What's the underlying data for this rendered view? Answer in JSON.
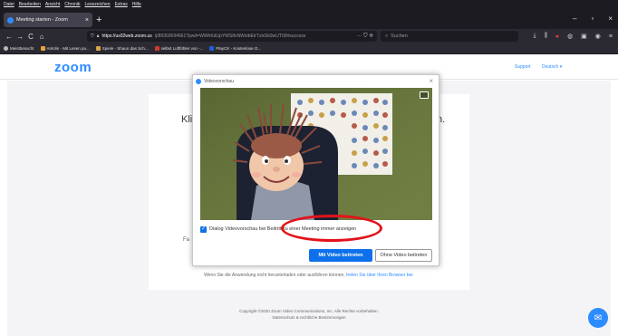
{
  "menubar": [
    "Datei",
    "Bearbeiten",
    "Ansicht",
    "Chronik",
    "Lesezeichen",
    "Extras",
    "Hilfe"
  ],
  "tab": {
    "title": "Meeting starten - Zoom",
    "close": "×"
  },
  "newtab": "+",
  "window_controls": [
    "–",
    "▫",
    "×"
  ],
  "nav": {
    "back": "←",
    "forward": "→",
    "reload": "C",
    "home": "⌂"
  },
  "url": {
    "host": "https://us02web.zoom.us",
    "rest": "/j/89303694661?pwd=WWhKdUpYWS8vNWxtbEtrTzlxSk9wUT09#success",
    "icons": "··· ⛉ ☆"
  },
  "search": {
    "placeholder": "Suchen"
  },
  "bookmarks": [
    "Meistbesucht",
    "Antolin - Mit Lesen pu...",
    "Spiele - Shaun das Sch...",
    "selbst Luftfühler von -...",
    "PlayCK - Kostenlose O..."
  ],
  "header": {
    "logo": "zoom",
    "support": "Support",
    "language": "Deutsch ▾"
  },
  "card": {
    "title_start": "Kli",
    "title_end": "n.",
    "fa": "Fa",
    "footer_text": "Wenn Sie die Anwendung nicht herunterladen oder ausführen können, ",
    "footer_link": "treten Sie über Ihren Browser bei."
  },
  "copyright": {
    "line1": "Copyright ©2020 Zoom Video Communications, Inc. Alle Rechte vorbehalten.",
    "line2": "Datenschutz & rechtliche Bestimmungen"
  },
  "dialog": {
    "title": "Videovorschau",
    "close": "×",
    "checkbox_label": "Dialog Videovorschau bei Beitritt zu einer Meeting immer anzeigen",
    "checkbox_checked": true,
    "join_with_video": "Mit Video beitreten",
    "join_without_video": "Ohne Video beitreten"
  },
  "colors": {
    "accent": "#2d8cff",
    "button_blue": "#0e71eb",
    "highlight_red": "#e4121a"
  }
}
